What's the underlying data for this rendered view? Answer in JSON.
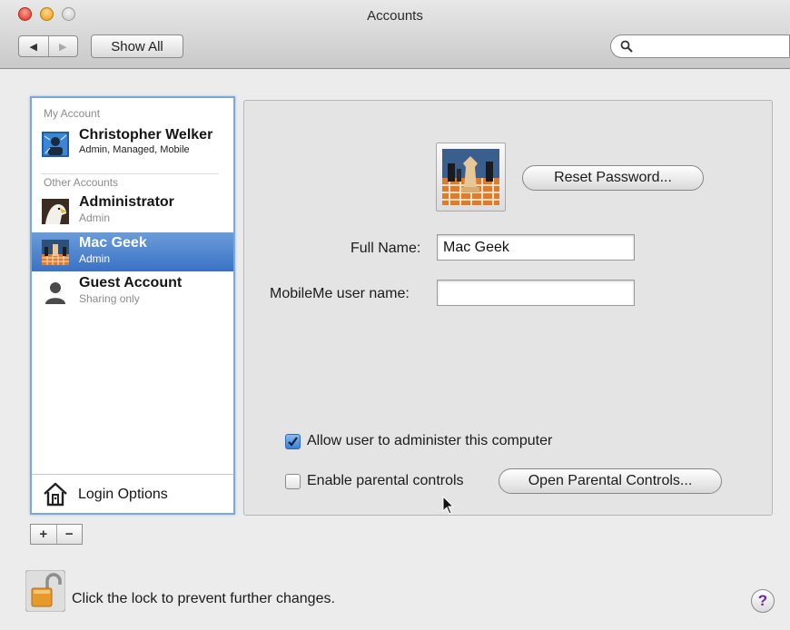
{
  "window": {
    "title": "Accounts"
  },
  "toolbar": {
    "back_glyph": "◀",
    "forward_glyph": "▶",
    "show_all_label": "Show All",
    "search_placeholder": "",
    "search_icon": "magnifier-icon"
  },
  "sidebar": {
    "my_account_header": "My Account",
    "other_accounts_header": "Other Accounts",
    "accounts": [
      {
        "name": "Christopher Welker",
        "role": "Admin, Managed, Mobile",
        "icon": "user-photo-icon",
        "selected": false
      },
      {
        "name": "Administrator",
        "role": "Admin",
        "icon": "eagle-photo-icon",
        "selected": false
      },
      {
        "name": "Mac Geek",
        "role": "Admin",
        "icon": "chess-photo-icon",
        "selected": true
      },
      {
        "name": "Guest Account",
        "role": "Sharing only",
        "icon": "guest-silhouette-icon",
        "selected": false
      }
    ],
    "login_options_label": "Login Options",
    "add_glyph": "+",
    "remove_glyph": "−"
  },
  "detail": {
    "reset_password_label": "Reset Password...",
    "full_name_label": "Full Name:",
    "full_name_value": "Mac Geek",
    "mobileme_label": "MobileMe user name:",
    "mobileme_value": "",
    "allow_admin_label": "Allow user to administer this computer",
    "allow_admin_checked": true,
    "parental_label": "Enable parental controls",
    "parental_checked": false,
    "open_parental_label": "Open Parental Controls..."
  },
  "footer": {
    "lock_text": "Click the lock to prevent further changes.",
    "help_glyph": "?"
  },
  "colors": {
    "selection": "#3a72c5",
    "focus_ring": "#7ba7d9",
    "help_accent": "#6b2aa6"
  }
}
